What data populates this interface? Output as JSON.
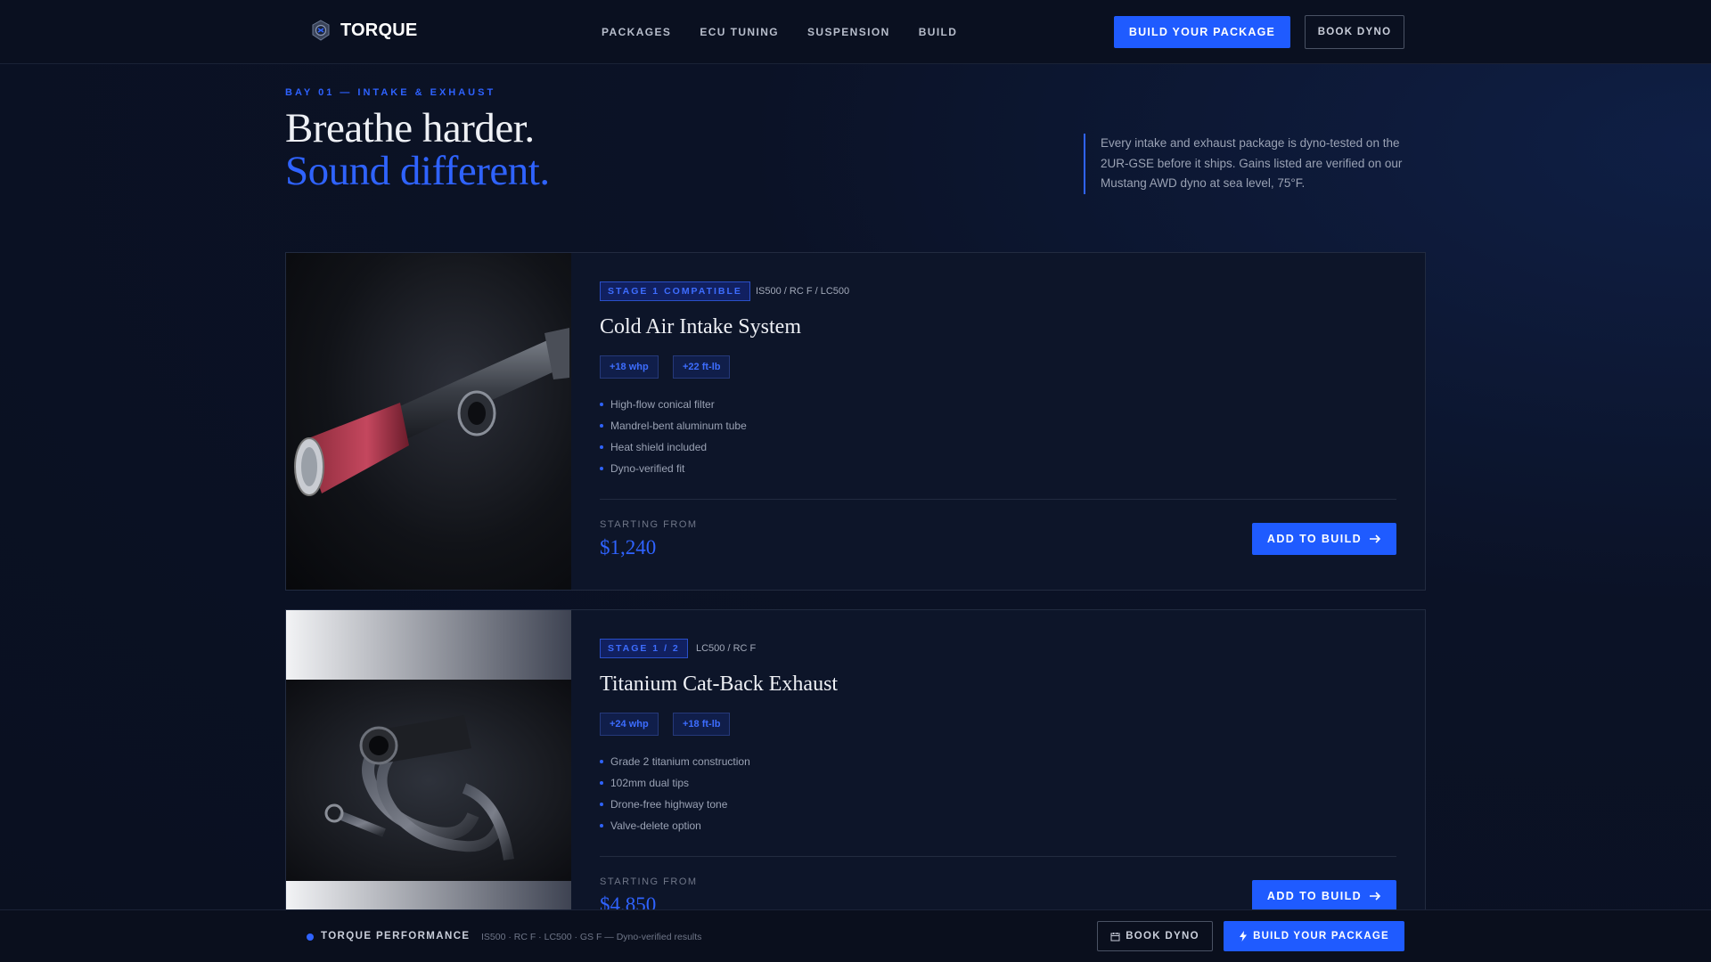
{
  "header": {
    "brand": "TORQUE",
    "nav": [
      "PACKAGES",
      "ECU TUNING",
      "SUSPENSION",
      "BUILD"
    ],
    "primary_cta": "BUILD YOUR PACKAGE",
    "secondary_cta": "BOOK DYNO"
  },
  "hero": {
    "eyebrow": "BAY 01 — INTAKE & EXHAUST",
    "title_line1": "Breathe harder.",
    "title_line2": "Sound different.",
    "intro": "Every intake and exhaust package is dyno-tested on the 2UR-GSE before it ships. Gains listed are verified on our Mustang AWD dyno at sea level, 75°F."
  },
  "products": [
    {
      "stage": "STAGE 1 COMPATIBLE",
      "fitment": "IS500 / RC F / LC500",
      "title": "Cold Air Intake System",
      "gains": [
        "+18 whp",
        "+22 ft-lb"
      ],
      "features": [
        "High-flow conical filter",
        "Mandrel-bent aluminum tube",
        "Heat shield included",
        "Dyno-verified fit"
      ],
      "price_label": "STARTING FROM",
      "price": "$1,240",
      "cta": "ADD TO BUILD"
    },
    {
      "stage": "STAGE 1 / 2",
      "fitment": "LC500 / RC F",
      "title": "Titanium Cat-Back Exhaust",
      "gains": [
        "+24 whp",
        "+18 ft-lb"
      ],
      "features": [
        "Grade 2 titanium construction",
        "102mm dual tips",
        "Drone-free highway tone",
        "Valve-delete option"
      ],
      "price_label": "STARTING FROM",
      "price": "$4,850",
      "cta": "ADD TO BUILD"
    }
  ],
  "bottombar": {
    "brand": "TORQUE PERFORMANCE",
    "meta": "IS500 · RC F · LC500 · GS F — Dyno-verified results",
    "book": "BOOK DYNO",
    "build": "BUILD YOUR PACKAGE"
  },
  "colors": {
    "accent": "#1f5bff",
    "background": "#0b1226",
    "card": "#0d1529"
  },
  "icons": [
    "torque-logo-icon",
    "arrow-right-icon",
    "calendar-icon",
    "bolt-icon"
  ]
}
